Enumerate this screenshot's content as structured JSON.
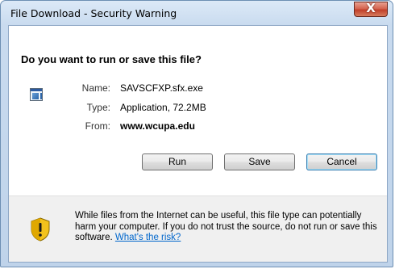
{
  "window": {
    "title": "File Download - Security Warning",
    "close_glyph": "X"
  },
  "prompt": {
    "heading": "Do you want to run or save this file?"
  },
  "file": {
    "icon": "application-file-icon",
    "name_label": "Name:",
    "name_value": "SAVSCFXP.sfx.exe",
    "type_label": "Type:",
    "type_value": "Application, 72.2MB",
    "from_label": "From:",
    "from_value": "www.wcupa.edu"
  },
  "buttons": {
    "run": "Run",
    "save": "Save",
    "cancel": "Cancel"
  },
  "warning": {
    "icon": "security-shield-warning-icon",
    "text": "While files from the Internet can be useful, this file type can potentially harm your computer. If you do not trust the source, do not run or save this software.",
    "link": "What's the risk?"
  },
  "colors": {
    "link": "#0066cc",
    "close_button": "#c1402a",
    "shield_yellow": "#f2c21c"
  }
}
